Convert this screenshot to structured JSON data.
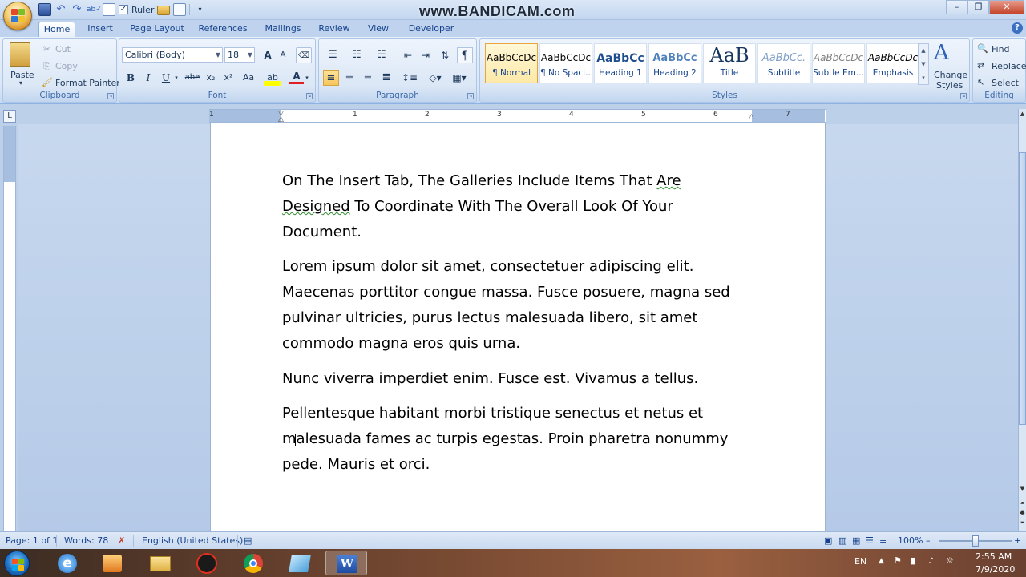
{
  "title_bar": {
    "qat_ruler_label": "Ruler",
    "ruler_checked": "✓",
    "watermark": "www.BANDICAM.com",
    "min": "–",
    "max": "❐",
    "close": "✕"
  },
  "tabs": [
    "Home",
    "Insert",
    "Page Layout",
    "References",
    "Mailings",
    "Review",
    "View",
    "Developer"
  ],
  "clipboard": {
    "paste": "Paste",
    "cut": "Cut",
    "copy": "Copy",
    "format_painter": "Format Painter",
    "label": "Clipboard"
  },
  "font": {
    "family": "Calibri (Body)",
    "size": "18",
    "grow": "A",
    "shrink": "A",
    "bold": "B",
    "italic": "I",
    "underline": "U",
    "strike": "abe",
    "subscript": "x₂",
    "superscript": "x²",
    "change_case": "Aa",
    "highlight": "ab",
    "font_color": "A",
    "label": "Font"
  },
  "paragraph": {
    "label": "Paragraph",
    "pilcrow": "¶"
  },
  "styles": {
    "items": [
      {
        "sample": "AaBbCcDc",
        "name": "¶ Normal"
      },
      {
        "sample": "AaBbCcDc",
        "name": "¶ No Spaci..."
      },
      {
        "sample": "AaBbCc",
        "name": "Heading 1"
      },
      {
        "sample": "AaBbCc",
        "name": "Heading 2"
      },
      {
        "sample": "AaB",
        "name": "Title"
      },
      {
        "sample": "AaBbCc.",
        "name": "Subtitle"
      },
      {
        "sample": "AaBbCcDc",
        "name": "Subtle Em..."
      },
      {
        "sample": "AaBbCcDc",
        "name": "Emphasis"
      }
    ],
    "change_styles": "Change",
    "change_styles_2": "Styles",
    "label": "Styles"
  },
  "editing": {
    "find": "Find",
    "replace": "Replace",
    "select": "Select",
    "label": "Editing"
  },
  "ruler": {
    "numbers": [
      "1",
      "1",
      "2",
      "3",
      "4",
      "5",
      "6",
      "7"
    ]
  },
  "document": {
    "p1": [
      "On The Insert Tab, The Galleries Include Items That ",
      "Are",
      "Designed",
      " To Coordinate With The Overall Look Of Your",
      "Document."
    ],
    "p2": [
      "Lorem ipsum dolor sit amet, consectetuer adipiscing elit.",
      "Maecenas porttitor congue massa. Fusce posuere, magna sed",
      "pulvinar ultricies, purus lectus malesuada libero, sit amet",
      "commodo magna eros quis urna."
    ],
    "p3": [
      "Nunc viverra imperdiet enim. Fusce est. Vivamus a tellus."
    ],
    "p4": [
      "Pellentesque habitant morbi tristique senectus et netus et",
      "malesuada fames ac turpis egestas. Proin pharetra nonummy",
      "pede. Mauris et orci."
    ]
  },
  "status": {
    "page": "Page: 1 of 1",
    "words": "Words: 78",
    "language": "English (United States)",
    "zoom": "100%",
    "minus": "–",
    "plus": "+"
  },
  "taskbar": {
    "lang": "EN",
    "time": "2:55 AM",
    "date": "7/9/2020"
  }
}
